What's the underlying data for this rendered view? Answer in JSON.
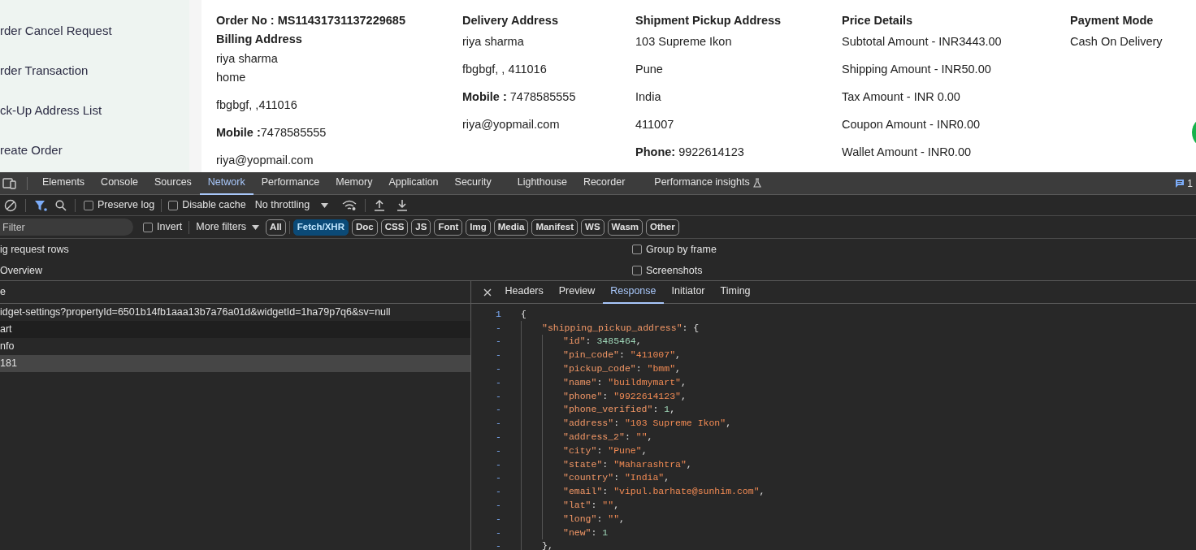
{
  "sidebar": {
    "items": [
      {
        "label": "rder Cancel Request"
      },
      {
        "label": "rder Transaction"
      },
      {
        "label": "ck-Up Address List"
      },
      {
        "label": "reate Order"
      }
    ]
  },
  "order": {
    "columns": [
      {
        "heading": "Order No : MS11431731137229685",
        "lines": [
          {
            "kind": "heading",
            "text": "Billing Address"
          },
          {
            "kind": "tight",
            "text": "riya sharma"
          },
          {
            "kind": "tight",
            "text": "home"
          },
          {
            "kind": "text",
            "text": "fbgbgf, ,411016"
          },
          {
            "kind": "text",
            "text": "**Mobile :**7478585555"
          },
          {
            "kind": "text",
            "text": "riya@yopmail.com"
          }
        ]
      },
      {
        "heading": "Delivery Address",
        "lines": [
          {
            "kind": "text",
            "text": "riya sharma"
          },
          {
            "kind": "text",
            "text": "fbgbgf, , 411016"
          },
          {
            "kind": "text",
            "text": "**Mobile :** 7478585555"
          },
          {
            "kind": "text",
            "text": "riya@yopmail.com"
          }
        ]
      },
      {
        "heading": "Shipment Pickup Address",
        "lines": [
          {
            "kind": "text",
            "text": "103 Supreme Ikon"
          },
          {
            "kind": "text",
            "text": "Pune"
          },
          {
            "kind": "text",
            "text": "India"
          },
          {
            "kind": "text",
            "text": "411007"
          },
          {
            "kind": "text",
            "text": "**Phone:** 9922614123"
          }
        ]
      },
      {
        "heading": "Price Details",
        "lines": [
          {
            "kind": "text",
            "text": "Subtotal Amount - INR3443.00"
          },
          {
            "kind": "text",
            "text": "Shipping Amount - INR50.00"
          },
          {
            "kind": "text",
            "text": "Tax Amount - INR 0.00"
          },
          {
            "kind": "text",
            "text": "Coupon Amount - INR0.00"
          },
          {
            "kind": "text",
            "text": "Wallet Amount - INR0.00"
          }
        ]
      },
      {
        "heading": "Payment Mode",
        "lines": [
          {
            "kind": "text",
            "text": "Cash On Delivery"
          }
        ]
      }
    ]
  },
  "devtools": {
    "tabs": [
      {
        "label": "Elements",
        "selected": false
      },
      {
        "label": "Console",
        "selected": false
      },
      {
        "label": "Sources",
        "selected": false
      },
      {
        "label": "Network",
        "selected": true
      },
      {
        "label": "Performance",
        "selected": false
      },
      {
        "label": "Memory",
        "selected": false
      },
      {
        "label": "Application",
        "selected": false
      },
      {
        "label": "Security",
        "selected": false
      },
      {
        "label": "Lighthouse",
        "selected": false
      },
      {
        "label": "Recorder",
        "selected": false
      },
      {
        "label": "Performance insights",
        "selected": false
      }
    ],
    "issues_count": "1",
    "toolbar": {
      "preserve_log": {
        "label": "Preserve log",
        "checked": false
      },
      "disable_cache": {
        "label": "Disable cache",
        "checked": false
      },
      "throttling": "No throttling"
    },
    "filter": {
      "placeholder": "Filter",
      "invert": {
        "label": "Invert",
        "checked": false
      },
      "more_filters": "More filters",
      "types": [
        {
          "label": "All",
          "selected": false
        },
        {
          "label": "Fetch/XHR",
          "selected": true
        },
        {
          "label": "Doc",
          "selected": false
        },
        {
          "label": "CSS",
          "selected": false
        },
        {
          "label": "JS",
          "selected": false
        },
        {
          "label": "Font",
          "selected": false
        },
        {
          "label": "Img",
          "selected": false
        },
        {
          "label": "Media",
          "selected": false
        },
        {
          "label": "Manifest",
          "selected": false
        },
        {
          "label": "WS",
          "selected": false
        },
        {
          "label": "Wasm",
          "selected": false
        },
        {
          "label": "Other",
          "selected": false
        }
      ]
    },
    "options_left": [
      {
        "label": "ig request rows"
      },
      {
        "label": "Overview"
      }
    ],
    "options_right": [
      {
        "label": "Group by frame",
        "checked": false
      },
      {
        "label": "Screenshots",
        "checked": false
      }
    ],
    "requests": {
      "column_1": "e",
      "rows": [
        {
          "name": "idget-settings?propertyId=6501b14fb1aaa13b7a76a01d&widgetId=1ha79p7q6&sv=null",
          "selected": false
        },
        {
          "name": "art",
          "selected": false
        },
        {
          "name": "nfo",
          "selected": false
        },
        {
          "name": "181",
          "selected": true
        }
      ]
    },
    "detail_tabs": [
      {
        "label": "Headers",
        "selected": false
      },
      {
        "label": "Preview",
        "selected": false
      },
      {
        "label": "Response",
        "selected": true
      },
      {
        "label": "Initiator",
        "selected": false
      },
      {
        "label": "Timing",
        "selected": false
      }
    ],
    "response": {
      "gutter": "1",
      "tokens": [
        {
          "kind": "punct",
          "text": "{"
        }
      ],
      "children": [
        {
          "gutter": "-",
          "tokens": [
            {
              "kind": "key",
              "text": "\"shipping_pickup_address\""
            },
            {
              "kind": "punct",
              "text": ": {"
            }
          ],
          "close": {
            "gutter": "-",
            "text": "},"
          },
          "children": [
            {
              "gutter": "-",
              "tokens": [
                {
                  "kind": "key",
                  "text": "\"id\""
                },
                {
                  "kind": "punct",
                  "text": ": "
                },
                {
                  "kind": "number",
                  "text": "3485464"
                },
                {
                  "kind": "punct",
                  "text": ","
                }
              ]
            },
            {
              "gutter": "-",
              "tokens": [
                {
                  "kind": "key",
                  "text": "\"pin_code\""
                },
                {
                  "kind": "punct",
                  "text": ": "
                },
                {
                  "kind": "string",
                  "text": "\"411007\""
                },
                {
                  "kind": "punct",
                  "text": ","
                }
              ]
            },
            {
              "gutter": "-",
              "tokens": [
                {
                  "kind": "key",
                  "text": "\"pickup_code\""
                },
                {
                  "kind": "punct",
                  "text": ": "
                },
                {
                  "kind": "string",
                  "text": "\"bmm\""
                },
                {
                  "kind": "punct",
                  "text": ","
                }
              ]
            },
            {
              "gutter": "-",
              "tokens": [
                {
                  "kind": "key",
                  "text": "\"name\""
                },
                {
                  "kind": "punct",
                  "text": ": "
                },
                {
                  "kind": "string",
                  "text": "\"buildmymart\""
                },
                {
                  "kind": "punct",
                  "text": ","
                }
              ]
            },
            {
              "gutter": "-",
              "tokens": [
                {
                  "kind": "key",
                  "text": "\"phone\""
                },
                {
                  "kind": "punct",
                  "text": ": "
                },
                {
                  "kind": "string",
                  "text": "\"9922614123\""
                },
                {
                  "kind": "punct",
                  "text": ","
                }
              ]
            },
            {
              "gutter": "-",
              "tokens": [
                {
                  "kind": "key",
                  "text": "\"phone_verified\""
                },
                {
                  "kind": "punct",
                  "text": ": "
                },
                {
                  "kind": "number",
                  "text": "1"
                },
                {
                  "kind": "punct",
                  "text": ","
                }
              ]
            },
            {
              "gutter": "-",
              "tokens": [
                {
                  "kind": "key",
                  "text": "\"address\""
                },
                {
                  "kind": "punct",
                  "text": ": "
                },
                {
                  "kind": "string",
                  "text": "\"103 Supreme Ikon\""
                },
                {
                  "kind": "punct",
                  "text": ","
                }
              ]
            },
            {
              "gutter": "-",
              "tokens": [
                {
                  "kind": "key",
                  "text": "\"address_2\""
                },
                {
                  "kind": "punct",
                  "text": ": "
                },
                {
                  "kind": "string",
                  "text": "\"\""
                },
                {
                  "kind": "punct",
                  "text": ","
                }
              ]
            },
            {
              "gutter": "-",
              "tokens": [
                {
                  "kind": "key",
                  "text": "\"city\""
                },
                {
                  "kind": "punct",
                  "text": ": "
                },
                {
                  "kind": "string",
                  "text": "\"Pune\""
                },
                {
                  "kind": "punct",
                  "text": ","
                }
              ]
            },
            {
              "gutter": "-",
              "tokens": [
                {
                  "kind": "key",
                  "text": "\"state\""
                },
                {
                  "kind": "punct",
                  "text": ": "
                },
                {
                  "kind": "string",
                  "text": "\"Maharashtra\""
                },
                {
                  "kind": "punct",
                  "text": ","
                }
              ]
            },
            {
              "gutter": "-",
              "tokens": [
                {
                  "kind": "key",
                  "text": "\"country\""
                },
                {
                  "kind": "punct",
                  "text": ": "
                },
                {
                  "kind": "string",
                  "text": "\"India\""
                },
                {
                  "kind": "punct",
                  "text": ","
                }
              ]
            },
            {
              "gutter": "-",
              "tokens": [
                {
                  "kind": "key",
                  "text": "\"email\""
                },
                {
                  "kind": "punct",
                  "text": ": "
                },
                {
                  "kind": "string",
                  "text": "\"vipul.barhate@sunhim.com\""
                },
                {
                  "kind": "punct",
                  "text": ","
                }
              ]
            },
            {
              "gutter": "-",
              "tokens": [
                {
                  "kind": "key",
                  "text": "\"lat\""
                },
                {
                  "kind": "punct",
                  "text": ": "
                },
                {
                  "kind": "string",
                  "text": "\"\""
                },
                {
                  "kind": "punct",
                  "text": ","
                }
              ]
            },
            {
              "gutter": "-",
              "tokens": [
                {
                  "kind": "key",
                  "text": "\"long\""
                },
                {
                  "kind": "punct",
                  "text": ": "
                },
                {
                  "kind": "string",
                  "text": "\"\""
                },
                {
                  "kind": "punct",
                  "text": ","
                }
              ]
            },
            {
              "gutter": "-",
              "tokens": [
                {
                  "kind": "key",
                  "text": "\"new\""
                },
                {
                  "kind": "punct",
                  "text": ": "
                },
                {
                  "kind": "number",
                  "text": "1"
                }
              ]
            }
          ]
        }
      ]
    }
  }
}
